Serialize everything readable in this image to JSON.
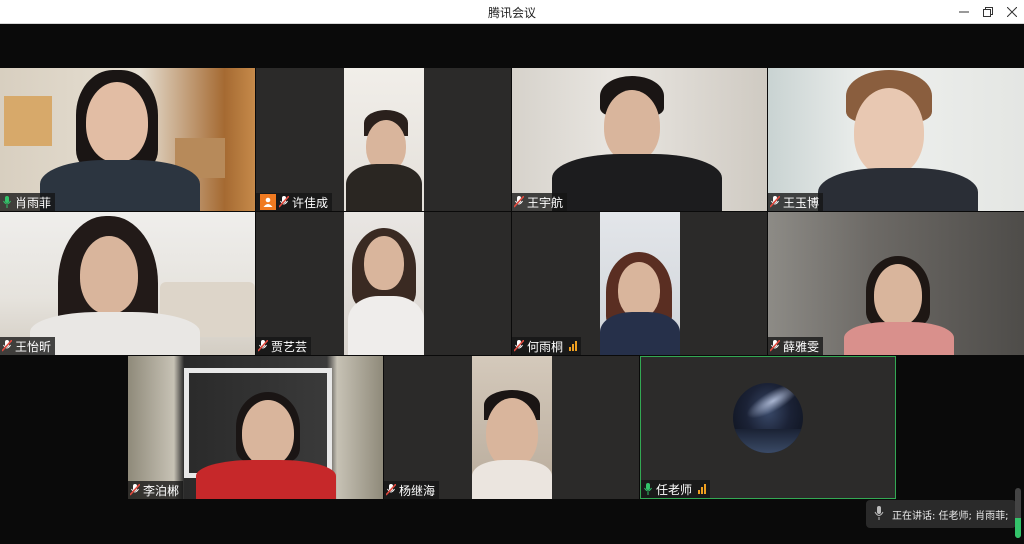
{
  "window": {
    "title": "腾讯会议",
    "minimize_icon": "minimize-icon",
    "maximize_icon": "restore-icon",
    "close_icon": "close-icon"
  },
  "participants": [
    {
      "name": "肖雨菲",
      "mic": "active-green"
    },
    {
      "name": "许佳成",
      "mic": "muted",
      "badge": "user-avatar-icon"
    },
    {
      "name": "王宇航",
      "mic": "muted"
    },
    {
      "name": "王玉博",
      "mic": "muted"
    },
    {
      "name": "王怡昕",
      "mic": "muted"
    },
    {
      "name": "贾艺芸",
      "mic": "muted"
    },
    {
      "name": "何雨桐",
      "mic": "muted",
      "signal": "signal-bars-icon"
    },
    {
      "name": "薛雅雯",
      "mic": "muted"
    },
    {
      "name": "李泊郴",
      "mic": "muted"
    },
    {
      "name": "杨继海",
      "mic": "muted"
    },
    {
      "name": "任老师",
      "mic": "active-green",
      "signal": "signal-bars-icon",
      "avatar": "starry-sky"
    }
  ],
  "speaking": {
    "text": "正在讲话: 任老师; 肖雨菲;"
  },
  "colors": {
    "active_border": "#33a853",
    "mic_active": "#33c36a",
    "mic_muted": "#e04a3f",
    "badge": "#f07a21",
    "signal": "#f0a020"
  }
}
